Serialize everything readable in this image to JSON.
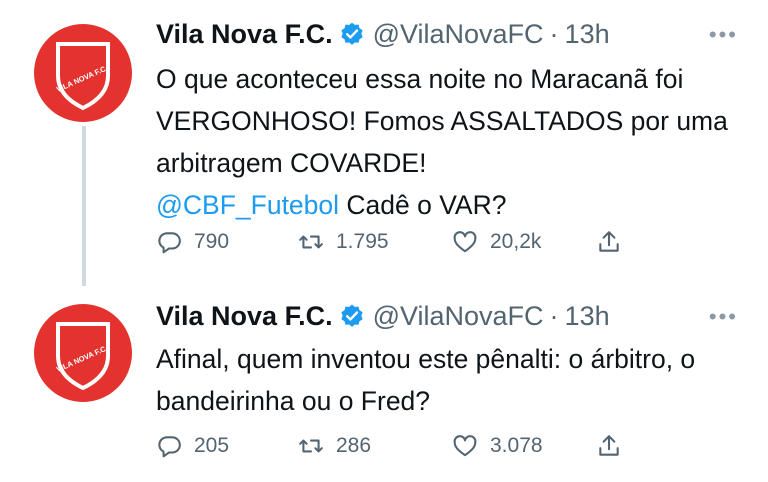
{
  "tweets": [
    {
      "author": {
        "name": "Vila Nova F.C.",
        "handle": "@VilaNovaFC",
        "time": "13h",
        "avatar_text": "VILA NOVA F.C."
      },
      "text_parts": [
        "O que aconteceu essa noite no Maracanã foi VERGONHOSO! Fomos ASSALTADOS por uma arbitragem COVARDE!\n",
        "@CBF_Futebol",
        " Cadê o VAR?"
      ],
      "stats": {
        "replies": "790",
        "retweets": "1.795",
        "likes": "20,2k"
      }
    },
    {
      "author": {
        "name": "Vila Nova F.C.",
        "handle": "@VilaNovaFC",
        "time": "13h",
        "avatar_text": "VILA NOVA F.C."
      },
      "text": "Afinal, quem inventou este pênalti: o árbitro, o bandeirinha ou o Fred?",
      "stats": {
        "replies": "205",
        "retweets": "286",
        "likes": "3.078"
      }
    }
  ],
  "ui": {
    "separator": "·",
    "more": "•••"
  },
  "colors": {
    "brand_red": "#e4332f",
    "link_blue": "#1d9bf0",
    "verified_blue": "#1d9bf0",
    "muted": "#536471"
  },
  "icons": [
    "verified-badge-icon",
    "more-options-icon",
    "reply-icon",
    "retweet-icon",
    "like-icon",
    "share-icon"
  ]
}
